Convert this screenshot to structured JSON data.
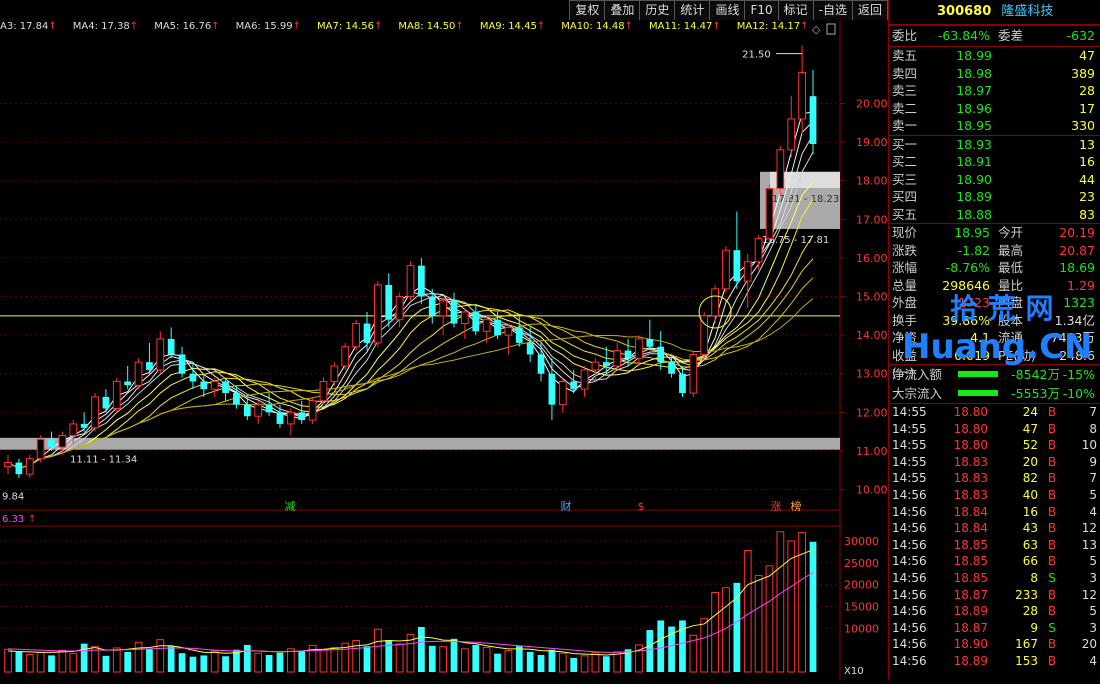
{
  "toolbar": [
    "复权",
    "叠加",
    "历史",
    "统计",
    "画线",
    "F10",
    "标记",
    "-自选",
    "返回"
  ],
  "ma_labels": [
    "A3: 17.84",
    "MA4: 17.38",
    "MA5: 16.76",
    "MA6: 15.99",
    "MA7: 14.56",
    "MA8: 14.50",
    "MA9: 14.45",
    "MA10: 14.48",
    "MA11: 14.47",
    "MA12: 14.17"
  ],
  "stock": {
    "code": "300680",
    "name": "隆盛科技"
  },
  "committee": {
    "ratio_label": "委比",
    "ratio": "-63.84%",
    "diff_label": "委差",
    "diff": "-632"
  },
  "asks": [
    {
      "label": "卖五",
      "price": "18.99",
      "vol": "47"
    },
    {
      "label": "卖四",
      "price": "18.98",
      "vol": "389"
    },
    {
      "label": "卖三",
      "price": "18.97",
      "vol": "28"
    },
    {
      "label": "卖二",
      "price": "18.96",
      "vol": "17"
    },
    {
      "label": "卖一",
      "price": "18.95",
      "vol": "330"
    }
  ],
  "bids": [
    {
      "label": "买一",
      "price": "18.93",
      "vol": "13"
    },
    {
      "label": "买二",
      "price": "18.91",
      "vol": "16"
    },
    {
      "label": "买三",
      "price": "18.90",
      "vol": "44"
    },
    {
      "label": "买四",
      "price": "18.89",
      "vol": "23"
    },
    {
      "label": "买五",
      "price": "18.88",
      "vol": "83"
    }
  ],
  "quote": [
    {
      "l1": "现价",
      "v1": "18.95",
      "c1": "green",
      "l2": "今开",
      "v2": "20.19",
      "c2": "red"
    },
    {
      "l1": "涨跌",
      "v1": "-1.82",
      "c1": "green",
      "l2": "最高",
      "v2": "20.87",
      "c2": "red"
    },
    {
      "l1": "涨幅",
      "v1": "-8.76%",
      "c1": "green",
      "l2": "最低",
      "v2": "18.69",
      "c2": "green"
    },
    {
      "l1": "总量",
      "v1": "298646",
      "c1": "yellow",
      "l2": "量比",
      "v2": "1.29",
      "c2": "red"
    },
    {
      "l1": "外盘",
      "v1": "1723",
      "c1": "red",
      "l2": "内盘",
      "v2": "1323",
      "c2": "green"
    },
    {
      "l1": "换手",
      "v1": "39.86%",
      "c1": "yellow",
      "l2": "股本",
      "v2": "1.34亿",
      "c2": "white"
    },
    {
      "l1": "净资",
      "v1": "4.1",
      "c1": "yellow",
      "l2": "流通",
      "v2": "7493万",
      "c2": "white"
    },
    {
      "l1": "收益(一)",
      "v1": "0.019",
      "c1": "yellow",
      "l2": "PE(动)",
      "v2": "248.6",
      "c2": "white"
    }
  ],
  "flows": [
    {
      "label": "净流入额",
      "value": "-8542万",
      "pct": "-15%"
    },
    {
      "label": "大宗流入",
      "value": "-5553万",
      "pct": "-10%"
    }
  ],
  "trades": [
    {
      "t": "14:55",
      "p": "18.80",
      "v": "24",
      "d": "B",
      "n": "7"
    },
    {
      "t": "14:55",
      "p": "18.80",
      "v": "47",
      "d": "B",
      "n": "8"
    },
    {
      "t": "14:55",
      "p": "18.80",
      "v": "52",
      "d": "B",
      "n": "10"
    },
    {
      "t": "14:55",
      "p": "18.83",
      "v": "20",
      "d": "B",
      "n": "9"
    },
    {
      "t": "14:55",
      "p": "18.83",
      "v": "82",
      "d": "B",
      "n": "7"
    },
    {
      "t": "14:56",
      "p": "18.83",
      "v": "40",
      "d": "B",
      "n": "5"
    },
    {
      "t": "14:56",
      "p": "18.84",
      "v": "16",
      "d": "B",
      "n": "4"
    },
    {
      "t": "14:56",
      "p": "18.84",
      "v": "43",
      "d": "B",
      "n": "12"
    },
    {
      "t": "14:56",
      "p": "18.85",
      "v": "63",
      "d": "B",
      "n": "13"
    },
    {
      "t": "14:56",
      "p": "18.85",
      "v": "66",
      "d": "B",
      "n": "5"
    },
    {
      "t": "14:56",
      "p": "18.85",
      "v": "8",
      "d": "S",
      "n": "3"
    },
    {
      "t": "14:56",
      "p": "18.87",
      "v": "233",
      "d": "B",
      "n": "12"
    },
    {
      "t": "14:56",
      "p": "18.89",
      "v": "28",
      "d": "B",
      "n": "5"
    },
    {
      "t": "14:56",
      "p": "18.87",
      "v": "9",
      "d": "S",
      "n": "3"
    },
    {
      "t": "14:56",
      "p": "18.90",
      "v": "167",
      "d": "B",
      "n": "20"
    },
    {
      "t": "14:56",
      "p": "18.89",
      "v": "153",
      "d": "B",
      "n": "4"
    }
  ],
  "price_axis": [
    "20.00",
    "19.00",
    "18.00",
    "17.00",
    "16.00",
    "15.00",
    "14.00",
    "13.00",
    "12.00",
    "11.00",
    "10.00"
  ],
  "vol_axis": [
    "30000",
    "25000",
    "20000",
    "15000",
    "10000"
  ],
  "vol_unit": "X10",
  "annotations": {
    "high": "21.50",
    "low": "9.84",
    "support": "11.11 - 11.34",
    "box_top": "17.81 - 18.23",
    "box_bottom": "16.75 - 17.81",
    "markers": [
      "减",
      "财",
      "$",
      "涨",
      "榜"
    ],
    "vol_ma": "6.33"
  },
  "watermark": {
    "text1": "拾 荒 网",
    "text2": "Huang.CN"
  },
  "chart_data": {
    "type": "candlestick",
    "ylim": [
      9.6,
      21.8
    ],
    "candles": [
      [
        10.6,
        10.9,
        10.4,
        10.7
      ],
      [
        10.7,
        10.8,
        10.3,
        10.4
      ],
      [
        10.4,
        10.9,
        10.3,
        10.8
      ],
      [
        10.8,
        11.4,
        10.7,
        11.3
      ],
      [
        11.3,
        11.5,
        11.0,
        11.1
      ],
      [
        11.1,
        11.5,
        10.9,
        11.4
      ],
      [
        11.4,
        11.8,
        11.2,
        11.7
      ],
      [
        11.7,
        12.0,
        11.5,
        11.6
      ],
      [
        11.6,
        12.5,
        11.5,
        12.4
      ],
      [
        12.4,
        12.6,
        12.0,
        12.1
      ],
      [
        12.1,
        12.9,
        12.0,
        12.8
      ],
      [
        12.8,
        13.2,
        12.6,
        12.7
      ],
      [
        12.7,
        13.4,
        12.6,
        13.3
      ],
      [
        13.3,
        13.8,
        13.0,
        13.1
      ],
      [
        13.1,
        14.1,
        13.0,
        13.9
      ],
      [
        13.9,
        14.2,
        13.4,
        13.5
      ],
      [
        13.5,
        13.7,
        12.9,
        13.0
      ],
      [
        13.0,
        13.3,
        12.6,
        12.8
      ],
      [
        12.8,
        13.0,
        12.4,
        12.6
      ],
      [
        12.6,
        12.9,
        12.4,
        12.8
      ],
      [
        12.8,
        12.9,
        12.3,
        12.5
      ],
      [
        12.5,
        12.7,
        12.1,
        12.2
      ],
      [
        12.2,
        12.4,
        11.8,
        11.9
      ],
      [
        11.9,
        12.3,
        11.7,
        12.2
      ],
      [
        12.2,
        12.5,
        11.9,
        12.0
      ],
      [
        12.0,
        12.2,
        11.6,
        11.7
      ],
      [
        11.7,
        12.1,
        11.4,
        12.0
      ],
      [
        12.0,
        12.3,
        11.7,
        11.8
      ],
      [
        11.8,
        12.4,
        11.7,
        12.3
      ],
      [
        12.3,
        12.9,
        12.2,
        12.8
      ],
      [
        12.8,
        13.3,
        12.7,
        13.2
      ],
      [
        13.2,
        13.8,
        13.1,
        13.7
      ],
      [
        13.7,
        14.4,
        13.6,
        14.3
      ],
      [
        14.3,
        14.6,
        13.6,
        13.8
      ],
      [
        13.8,
        15.4,
        13.7,
        15.3
      ],
      [
        15.3,
        15.6,
        14.2,
        14.4
      ],
      [
        14.4,
        15.1,
        14.2,
        15.0
      ],
      [
        15.0,
        15.9,
        14.9,
        15.8
      ],
      [
        15.8,
        16.0,
        14.8,
        15.0
      ],
      [
        15.0,
        15.2,
        14.3,
        14.5
      ],
      [
        14.5,
        15.0,
        14.0,
        14.9
      ],
      [
        14.9,
        15.1,
        14.2,
        14.3
      ],
      [
        14.3,
        14.7,
        13.9,
        14.6
      ],
      [
        14.6,
        14.8,
        14.0,
        14.1
      ],
      [
        14.1,
        14.5,
        13.8,
        14.4
      ],
      [
        14.4,
        14.6,
        13.9,
        14.0
      ],
      [
        14.0,
        14.3,
        13.5,
        14.2
      ],
      [
        14.2,
        14.5,
        13.7,
        13.8
      ],
      [
        13.8,
        14.2,
        13.3,
        13.5
      ],
      [
        13.5,
        13.8,
        12.8,
        13.0
      ],
      [
        13.0,
        13.4,
        11.8,
        12.2
      ],
      [
        12.2,
        12.9,
        12.0,
        12.8
      ],
      [
        12.8,
        13.1,
        12.5,
        12.6
      ],
      [
        12.6,
        13.2,
        12.4,
        13.1
      ],
      [
        13.1,
        13.4,
        12.8,
        13.3
      ],
      [
        13.3,
        13.7,
        13.0,
        13.2
      ],
      [
        13.2,
        13.8,
        13.1,
        13.6
      ],
      [
        13.6,
        13.9,
        13.2,
        13.4
      ],
      [
        13.4,
        14.0,
        13.2,
        13.9
      ],
      [
        13.9,
        14.4,
        13.6,
        13.7
      ],
      [
        13.7,
        14.1,
        13.1,
        13.3
      ],
      [
        13.3,
        13.5,
        12.9,
        13.0
      ],
      [
        13.0,
        13.2,
        12.4,
        12.5
      ],
      [
        12.5,
        13.6,
        12.4,
        13.5
      ],
      [
        13.5,
        14.6,
        13.4,
        14.5
      ],
      [
        14.5,
        15.3,
        14.3,
        15.2
      ],
      [
        15.2,
        16.3,
        15.1,
        16.2
      ],
      [
        16.2,
        17.2,
        15.2,
        15.4
      ],
      [
        15.4,
        16.1,
        14.7,
        15.9
      ],
      [
        15.9,
        16.6,
        15.7,
        16.5
      ],
      [
        16.5,
        17.9,
        16.4,
        17.8
      ],
      [
        17.8,
        18.9,
        17.6,
        18.8
      ],
      [
        18.8,
        20.2,
        18.6,
        19.6
      ],
      [
        19.6,
        21.5,
        19.2,
        20.8
      ],
      [
        20.19,
        20.87,
        18.69,
        18.95
      ]
    ],
    "volumes": [
      5200,
      4600,
      4000,
      4500,
      3800,
      5000,
      4200,
      6500,
      5800,
      3700,
      5500,
      4600,
      6800,
      5200,
      7400,
      5900,
      4300,
      3500,
      3800,
      4800,
      3600,
      5100,
      6200,
      4300,
      3900,
      4400,
      5300,
      4700,
      6100,
      5000,
      5600,
      6600,
      7200,
      5900,
      9800,
      7300,
      6400,
      8600,
      10300,
      6000,
      5800,
      7600,
      5300,
      6200,
      5600,
      4200,
      4900,
      5900,
      4600,
      3900,
      5100,
      4300,
      3200,
      3700,
      4400,
      3600,
      4600,
      5200,
      6200,
      9600,
      11800,
      10400,
      11800,
      8400,
      12200,
      18200,
      19300,
      20400,
      27800,
      22100,
      24300,
      32100,
      30000,
      31900,
      29800
    ],
    "ma_yellow": [
      4800,
      4700,
      4600,
      4500,
      4500,
      4600,
      4700,
      5200,
      5600,
      5000,
      5000,
      5200,
      5500,
      5600,
      6000,
      6000,
      5600,
      5000,
      4500,
      4500,
      4300,
      4400,
      4900,
      4800,
      4700,
      4600,
      4700,
      4800,
      5100,
      5200,
      5400,
      5600,
      6000,
      6200,
      7000,
      7200,
      7100,
      7300,
      8000,
      7800,
      7300,
      7200,
      6700,
      6500,
      6000,
      5600,
      5300,
      5300,
      5200,
      4900,
      4800,
      4600,
      4200,
      4100,
      4000,
      3900,
      4100,
      4400,
      5000,
      6000,
      7500,
      8700,
      9800,
      10600,
      11000,
      13000,
      15000,
      17000,
      20000,
      21000,
      22000,
      24000,
      26000,
      27000,
      28000
    ],
    "ma_magenta": [
      5300,
      5200,
      5100,
      5000,
      4900,
      4800,
      4800,
      4900,
      5000,
      5000,
      5100,
      5100,
      5200,
      5300,
      5400,
      5500,
      5500,
      5400,
      5200,
      5000,
      4900,
      4800,
      4800,
      4800,
      4700,
      4700,
      4700,
      4800,
      4900,
      5000,
      5100,
      5200,
      5400,
      5600,
      5900,
      6100,
      6300,
      6500,
      6800,
      7000,
      7000,
      7000,
      6900,
      6800,
      6600,
      6400,
      6200,
      6000,
      5800,
      5600,
      5400,
      5200,
      5000,
      4800,
      4600,
      4500,
      4500,
      4600,
      4800,
      5100,
      5500,
      6000,
      6600,
      7200,
      7800,
      8800,
      10000,
      11500,
      13200,
      14700,
      16200,
      18000,
      19600,
      21200,
      22800
    ]
  }
}
